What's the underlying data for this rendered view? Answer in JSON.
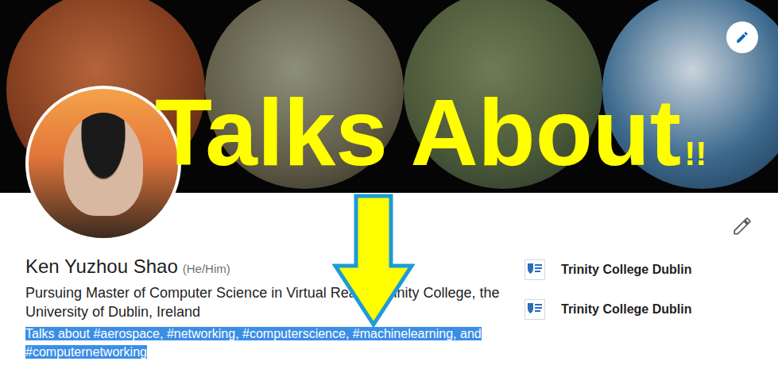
{
  "overlay": {
    "title": "Talks About",
    "suffix": "!!"
  },
  "profile": {
    "name": "Ken Yuzhou Shao",
    "pronouns": "(He/Him)",
    "headline": "Pursuing Master of Computer Science in Virtual Reality, Trinity College, the University of Dublin, Ireland",
    "talks_about": {
      "text": "Talks about #aerospace, #networking, #computerscience, #machinelearning, and #computernetworking",
      "selected": true
    }
  },
  "education": [
    {
      "name": "Trinity College Dublin"
    },
    {
      "name": "Trinity College Dublin"
    }
  ]
}
